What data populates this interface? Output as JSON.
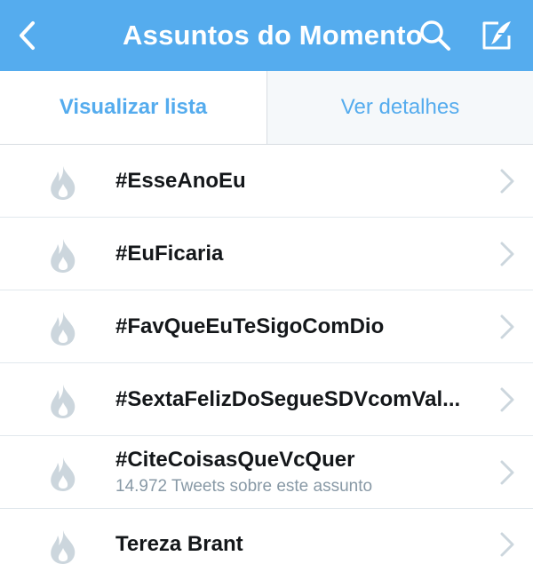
{
  "navbar": {
    "title": "Assuntos do Momento",
    "back_icon": "chevron-left-icon",
    "search_icon": "search-icon",
    "compose_icon": "compose-icon",
    "background": "#55acee"
  },
  "tabs": [
    {
      "label": "Visualizar lista",
      "active": true
    },
    {
      "label": "Ver detalhes",
      "active": false
    }
  ],
  "trends": [
    {
      "name": "#EsseAnoEu",
      "subtitle": ""
    },
    {
      "name": "#EuFicaria",
      "subtitle": ""
    },
    {
      "name": "#FavQueEuTeSigoComDio",
      "subtitle": ""
    },
    {
      "name": "#SextaFelizDoSegueSDVcomVal...",
      "subtitle": ""
    },
    {
      "name": "#CiteCoisasQueVcQuer",
      "subtitle": "14.972 Tweets sobre este assunto"
    },
    {
      "name": "Tereza Brant",
      "subtitle": ""
    }
  ],
  "colors": {
    "accent": "#55acee",
    "icon_gray": "#ccd6dd",
    "text": "#14171a",
    "secondary": "#8899a6"
  }
}
